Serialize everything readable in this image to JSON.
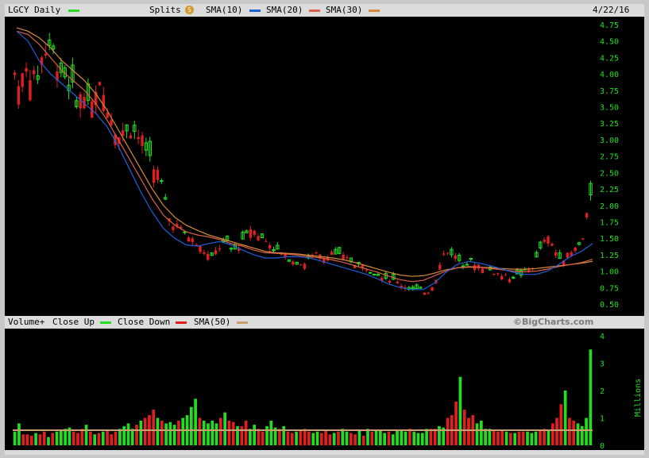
{
  "header": {
    "ticker": "LGCY Daily",
    "splits_label": "Splits",
    "splits_badge": "S",
    "sma10_label": "SMA(10)",
    "sma20_label": "SMA(20)",
    "sma30_label": "SMA(30)",
    "date": "4/22/16"
  },
  "volume_header": {
    "title": "Volume+",
    "close_up_label": "Close Up",
    "close_down_label": "Close Down",
    "sma50_label": "SMA(50)"
  },
  "watermark": "©BigCharts.com",
  "colors": {
    "up": "#22dd22",
    "down": "#e02020",
    "sma10": "#1e5fd8",
    "sma20": "#d9604a",
    "sma30": "#d88a3a",
    "vol_sma": "#c8a070",
    "ticks": "#22dd22"
  },
  "chart_data": [
    {
      "type": "candlestick",
      "title": "LGCY Daily",
      "ylim": [
        0.5,
        4.75
      ],
      "yticks": [
        "4.75",
        "4.50",
        "4.25",
        "4.00",
        "3.75",
        "3.50",
        "3.25",
        "3.00",
        "2.75",
        "2.50",
        "2.25",
        "2.00",
        "1.75",
        "1.50",
        "1.25",
        "1.00",
        "0.75",
        "0.50"
      ],
      "grid": false,
      "close_path": [
        4.0,
        3.9,
        4.1,
        3.85,
        4.3,
        4.45,
        4.2,
        4.0,
        3.8,
        3.6,
        3.7,
        3.5,
        3.8,
        3.6,
        3.3,
        3.0,
        3.2,
        3.15,
        3.0,
        2.8,
        2.6,
        2.3,
        1.8,
        1.7,
        1.6,
        1.5,
        1.4,
        1.3,
        1.2,
        1.35,
        1.45,
        1.3,
        1.4,
        1.6,
        1.7,
        1.5,
        1.45,
        1.35,
        1.25,
        1.2,
        1.15,
        1.1,
        1.2,
        1.25,
        1.2,
        1.3,
        1.25,
        1.2,
        1.15,
        1.1,
        1.05,
        1.0,
        0.95,
        0.9,
        0.85,
        0.8,
        0.75,
        0.72,
        0.7,
        0.7,
        0.9,
        1.25,
        1.3,
        1.2,
        1.1,
        1.15,
        1.1,
        1.05,
        1.0,
        0.95,
        0.9,
        0.92,
        0.95,
        1.0,
        1.1,
        1.4,
        1.5,
        1.3,
        1.2,
        1.25,
        1.35,
        1.5,
        2.2
      ],
      "sma10": [
        4.65,
        4.5,
        4.2,
        4.0,
        3.85,
        3.7,
        3.55,
        3.4,
        3.2,
        2.9,
        2.55,
        2.2,
        1.9,
        1.65,
        1.5,
        1.4,
        1.38,
        1.42,
        1.45,
        1.4,
        1.32,
        1.25,
        1.2,
        1.2,
        1.22,
        1.22,
        1.2,
        1.15,
        1.1,
        1.05,
        1.0,
        0.95,
        0.88,
        0.8,
        0.75,
        0.72,
        0.72,
        0.82,
        0.98,
        1.1,
        1.15,
        1.12,
        1.08,
        1.03,
        0.98,
        0.95,
        0.95,
        1.0,
        1.1,
        1.22,
        1.3,
        1.42
      ],
      "sma20": [
        4.65,
        4.6,
        4.45,
        4.25,
        4.05,
        3.9,
        3.75,
        3.55,
        3.3,
        3.0,
        2.7,
        2.4,
        2.1,
        1.85,
        1.7,
        1.6,
        1.55,
        1.52,
        1.48,
        1.42,
        1.38,
        1.32,
        1.28,
        1.27,
        1.26,
        1.24,
        1.22,
        1.2,
        1.17,
        1.13,
        1.08,
        1.03,
        0.98,
        0.92,
        0.87,
        0.84,
        0.86,
        0.93,
        1.0,
        1.05,
        1.07,
        1.06,
        1.04,
        1.02,
        1.0,
        0.99,
        1.0,
        1.03,
        1.07,
        1.1,
        1.13,
        1.18
      ],
      "sma30": [
        4.7,
        4.65,
        4.55,
        4.4,
        4.2,
        4.05,
        3.9,
        3.7,
        3.45,
        3.15,
        2.85,
        2.55,
        2.25,
        2.0,
        1.82,
        1.7,
        1.62,
        1.55,
        1.5,
        1.45,
        1.4,
        1.35,
        1.3,
        1.28,
        1.27,
        1.26,
        1.24,
        1.22,
        1.2,
        1.17,
        1.13,
        1.08,
        1.03,
        0.98,
        0.94,
        0.92,
        0.93,
        0.97,
        1.02,
        1.05,
        1.06,
        1.06,
        1.05,
        1.04,
        1.03,
        1.03,
        1.04,
        1.06,
        1.08,
        1.1,
        1.12,
        1.15
      ]
    },
    {
      "type": "bar",
      "title": "Volume+",
      "ylabel": "Millions",
      "ylim": [
        0,
        4
      ],
      "yticks": [
        "4",
        "3",
        "2",
        "1",
        "0"
      ],
      "volumes": [
        0.5,
        0.8,
        0.4,
        0.4,
        0.35,
        0.45,
        0.4,
        0.5,
        0.3,
        0.45,
        0.5,
        0.55,
        0.6,
        0.65,
        0.5,
        0.45,
        0.6,
        0.75,
        0.5,
        0.4,
        0.45,
        0.5,
        0.55,
        0.4,
        0.5,
        0.6,
        0.7,
        0.8,
        0.6,
        0.75,
        0.9,
        1.0,
        1.1,
        1.3,
        1.0,
        0.9,
        0.8,
        0.85,
        0.75,
        0.9,
        1.0,
        1.1,
        1.4,
        1.7,
        1.0,
        0.9,
        0.8,
        0.9,
        0.8,
        1.0,
        1.2,
        0.9,
        0.85,
        0.7,
        0.7,
        0.9,
        0.6,
        0.75,
        0.6,
        0.5,
        0.7,
        0.9,
        0.65,
        0.6,
        0.7,
        0.5,
        0.45,
        0.5,
        0.55,
        0.6,
        0.5,
        0.45,
        0.5,
        0.45,
        0.55,
        0.4,
        0.45,
        0.5,
        0.6,
        0.5,
        0.45,
        0.4,
        0.55,
        0.35,
        0.6,
        0.5,
        0.55,
        0.55,
        0.45,
        0.5,
        0.4,
        0.55,
        0.55,
        0.5,
        0.6,
        0.5,
        0.45,
        0.45,
        0.6,
        0.6,
        0.6,
        0.7,
        0.65,
        1.0,
        1.1,
        1.6,
        2.5,
        1.3,
        1.0,
        1.1,
        0.8,
        0.9,
        0.6,
        0.6,
        0.55,
        0.5,
        0.55,
        0.5,
        0.45,
        0.45,
        0.5,
        0.5,
        0.5,
        0.45,
        0.5,
        0.55,
        0.6,
        0.55,
        0.8,
        1.0,
        1.5,
        2.0,
        1.0,
        0.9,
        0.8,
        0.7,
        1.0,
        3.5
      ],
      "vol_sma": 0.55
    }
  ]
}
